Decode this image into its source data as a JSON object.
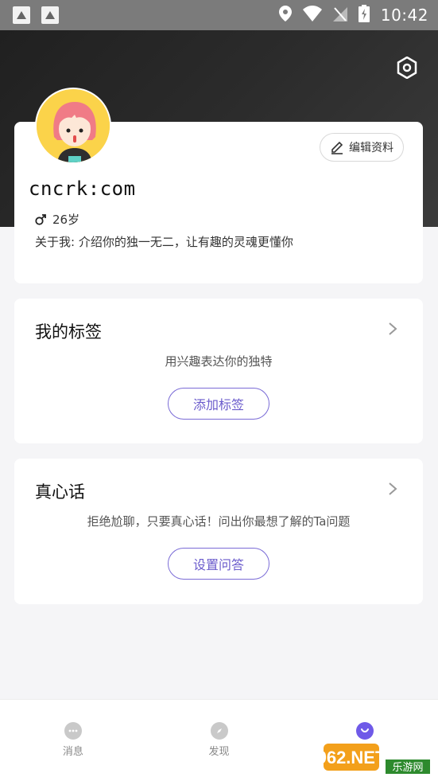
{
  "status_bar": {
    "time": "10:42"
  },
  "profile": {
    "username": "cncrk:com",
    "age": "26岁",
    "about": "关于我: 介绍你的独一无二，让有趣的灵魂更懂你",
    "edit_label": "编辑资料"
  },
  "tags_section": {
    "title": "我的标签",
    "description": "用兴趣表达你的独特",
    "button_label": "添加标签"
  },
  "truth_section": {
    "title": "真心话",
    "description": "拒绝尬聊，只要真心话！问出你最想了解的Ta问题",
    "button_label": "设置问答"
  },
  "bottom_nav": {
    "items": [
      {
        "label": "消息",
        "icon": "chat-icon"
      },
      {
        "label": "发现",
        "icon": "compass-icon"
      },
      {
        "label": "",
        "icon": "profile-smile-icon"
      }
    ]
  },
  "watermark": {
    "text": "962.NET",
    "subtext": "乐游网"
  },
  "colors": {
    "accent": "#6f5ae8",
    "avatar_bg": "#fbd34a"
  }
}
